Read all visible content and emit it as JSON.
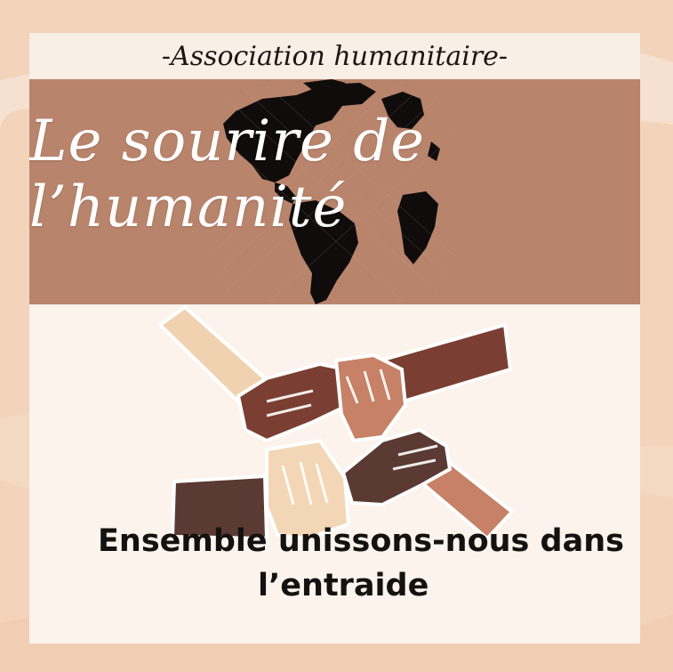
{
  "tagline": "-Association humanitaire-",
  "title": "Le sourire de l’humanité",
  "slogan": {
    "line1": "Ensemble unissons-nous dans",
    "line2": "l’entraide"
  },
  "colors": {
    "background": "#f3d3b9",
    "card": "#fbf3ec",
    "banner": "#b9846c",
    "title_text": "#ffffff",
    "skin_tones": [
      "#f1d2b0",
      "#7a3f32",
      "#c68166",
      "#5a3a33"
    ]
  },
  "icons": [
    "globe-icon",
    "joined-hands-icon"
  ]
}
